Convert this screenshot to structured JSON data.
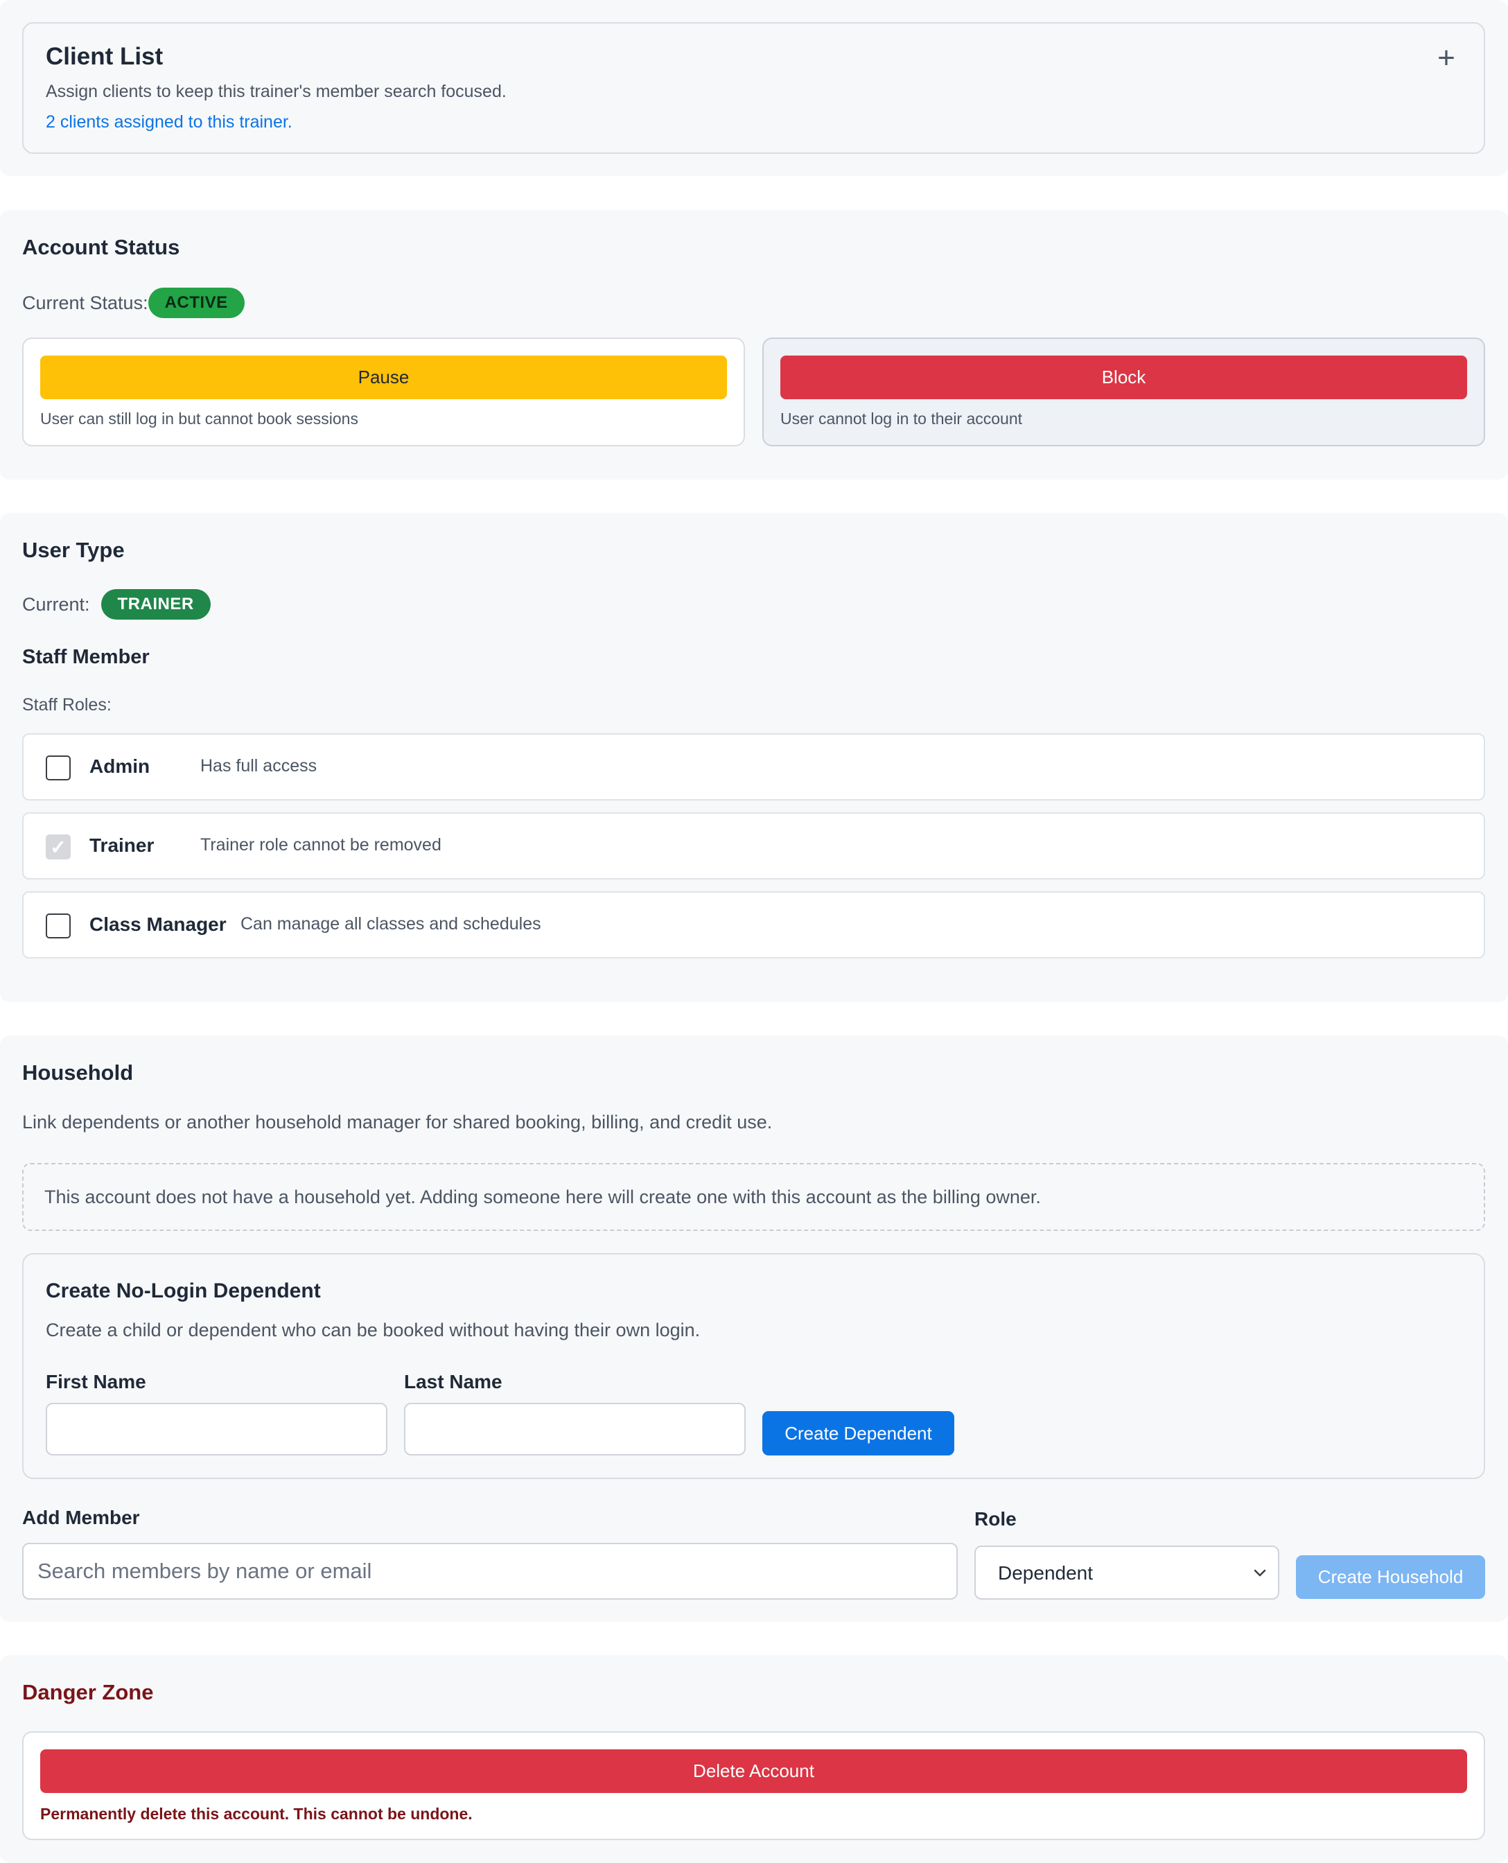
{
  "client_list": {
    "title": "Client List",
    "description": "Assign clients to keep this trainer's member search focused.",
    "count_text": "2 clients assigned to this trainer.",
    "add_icon": "plus-icon"
  },
  "account_status": {
    "title": "Account Status",
    "current_label": "Current Status:",
    "status_badge": "ACTIVE",
    "pause": {
      "label": "Pause",
      "note": "User can still log in but cannot book sessions",
      "color": "#ffc107"
    },
    "block": {
      "label": "Block",
      "note": "User cannot log in to their account",
      "color": "#dc3545"
    }
  },
  "user_type": {
    "title": "User Type",
    "current_label": "Current:",
    "current_badge": "TRAINER",
    "staff_title": "Staff Member",
    "roles_label": "Staff Roles:",
    "roles": [
      {
        "name": "Admin",
        "description": "Has full access",
        "checked": false,
        "disabled": false
      },
      {
        "name": "Trainer",
        "description": "Trainer role cannot be removed",
        "checked": true,
        "disabled": true
      },
      {
        "name": "Class Manager",
        "description": "Can manage all classes and schedules",
        "checked": false,
        "disabled": false
      }
    ]
  },
  "household": {
    "title": "Household",
    "description": "Link dependents or another household manager for shared booking, billing, and credit use.",
    "empty_note": "This account does not have a household yet. Adding someone here will create one with this account as the billing owner.",
    "dependent": {
      "title": "Create No-Login Dependent",
      "description": "Create a child or dependent who can be booked without having their own login.",
      "first_name_label": "First Name",
      "first_name_value": "",
      "last_name_label": "Last Name",
      "last_name_value": "",
      "create_button": "Create Dependent"
    },
    "add_member_label": "Add Member",
    "search_placeholder": "Search members by name or email",
    "role_label": "Role",
    "role_selected": "Dependent",
    "create_household_button": "Create Household"
  },
  "danger_zone": {
    "title": "Danger Zone",
    "delete_button": "Delete Account",
    "note": "Permanently delete this account. This cannot be undone."
  },
  "colors": {
    "accent": "#0b74e5",
    "danger": "#dc3545",
    "warning": "#ffc107",
    "success": "#22a447",
    "trainer_badge": "#1f874a",
    "disabled_button": "#7cb6f3"
  }
}
